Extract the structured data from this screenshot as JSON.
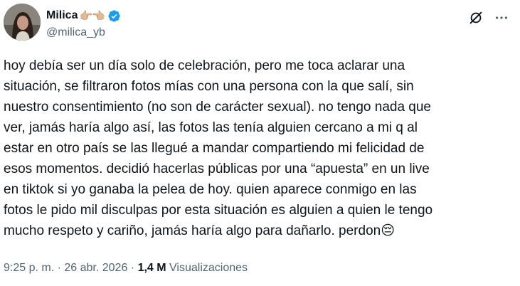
{
  "author": {
    "display_name": "Milica",
    "name_emoji": "👉🏼👈🏼",
    "handle": "@milica_yb",
    "verified": true,
    "avatar_icon": "avatar-photo"
  },
  "header_actions": {
    "grok_icon": "grok-icon",
    "more_icon": "more-icon"
  },
  "tweet": {
    "text": "hoy debía ser un día solo de celebración, pero me toca aclarar una\nsituación, se filtraron fotos mías con una persona con la que salí, sin\nnuestro consentimiento (no son de carácter sexual). no tengo nada que\nver,  jamás haría algo así, las fotos las tenía alguien cercano a mi q al\nestar en otro país se las llegué a mandar compartiendo mi felicidad de\nesos momentos.  decidió hacerlas públicas por una “apuesta” en un live\nen tiktok si yo ganaba la pelea de hoy. quien aparece conmigo en las\nfotos le pido mil disculpas por esta situación es alguien a quien le tengo\nmucho respeto y cariño,  jamás haría algo para dañarlo. perdon😔"
  },
  "meta": {
    "time": "9:25 p. m.",
    "separator": " · ",
    "date": "26 abr. 2026",
    "views_count": "1,4 M",
    "views_label": "Visualizaciones"
  },
  "colors": {
    "text": "#0f1419",
    "secondary": "#536471",
    "verified_blue": "#1d9bf0"
  }
}
